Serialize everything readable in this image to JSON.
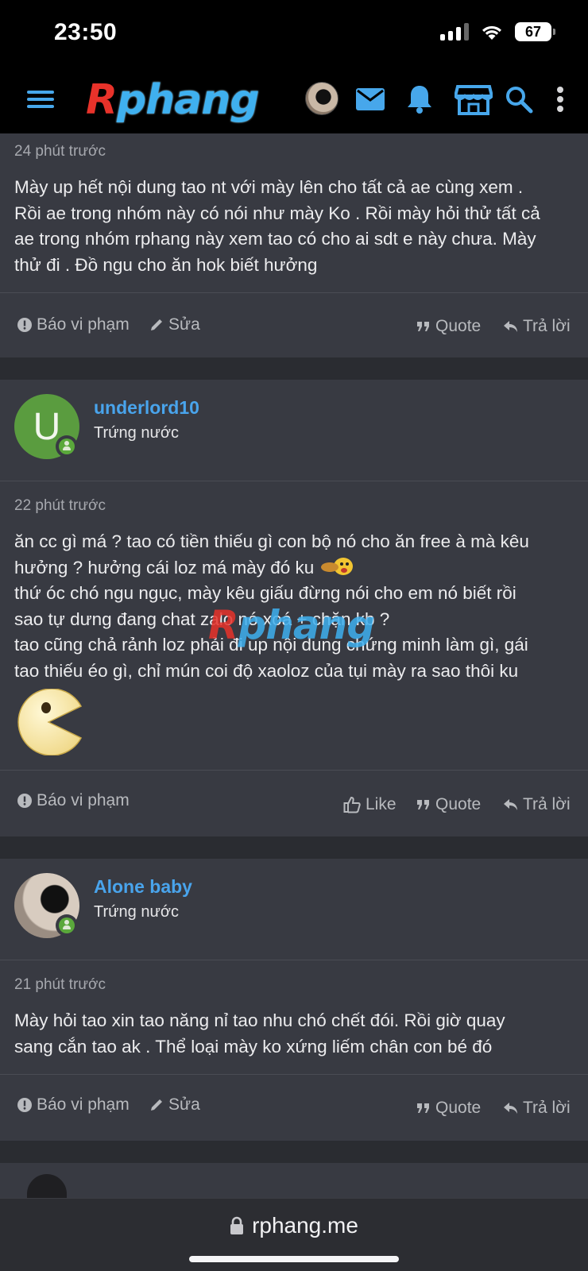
{
  "status": {
    "time": "23:50",
    "battery": "67"
  },
  "header": {
    "logo_r": "R",
    "logo_rest": "phang"
  },
  "posts": [
    {
      "time": "24 phút trước",
      "lines": [
        "Mày up hết nội dung tao nt với mày lên cho tất cả ae cùng xem .",
        "Rồi ae trong nhóm này có nói như mày Ko . Rồi mày hỏi thử tất cả",
        "ae trong nhóm rphang này xem tao có cho ai sdt e này chưa. Mày",
        "thử đi . Đồ ngu cho ăn hok biết hưởng"
      ],
      "report": "Báo vi phạm",
      "edit": "Sửa",
      "quote": "Quote",
      "reply": "Trả lời"
    },
    {
      "username": "underlord10",
      "usertitle": "Trứng nước",
      "avatar_letter": "U",
      "time": "22 phút trước",
      "lines": [
        "ăn cc gì má ? tao có tiền thiếu gì con bộ nó cho ăn free à mà kêu",
        "hưởng ? hưởng cái loz má mày đó ku",
        "thứ óc chó ngu ngục, mày kêu giấu đừng nói cho em nó biết rồi",
        "sao tự dưng đang chat zalo nó xoá + chặn kb ?",
        "tao cũng chả rảnh loz phải đi up nội dung chứng minh làm gì, gái",
        "tao thiếu éo gì, chỉ mún coi độ xaoloz của tụi mày ra sao thôi ku"
      ],
      "report": "Báo vi phạm",
      "like": "Like",
      "quote": "Quote",
      "reply": "Trả lời"
    },
    {
      "username": "Alone baby",
      "usertitle": "Trứng nước",
      "time": "21 phút trước",
      "lines": [
        "Mày hỏi tao xin tao năng nỉ tao nhu chó chết đói. Rồi giờ quay",
        "sang cắn tao ak . Thể loại mày ko xứng liếm chân con bé đó"
      ],
      "report": "Báo vi phạm",
      "edit": "Sửa",
      "quote": "Quote",
      "reply": "Trả lời"
    }
  ],
  "watermark": {
    "r": "R",
    "rest": "phang"
  },
  "address": {
    "url": "rphang.me"
  },
  "colors": {
    "accent": "#49a4ec",
    "logo_red": "#e8322a",
    "online": "#5aa83b",
    "card": "#383a42"
  },
  "icons": [
    "menu-icon",
    "mail-icon",
    "bell-icon",
    "store-icon",
    "search-icon",
    "more-icon",
    "lock-icon"
  ]
}
